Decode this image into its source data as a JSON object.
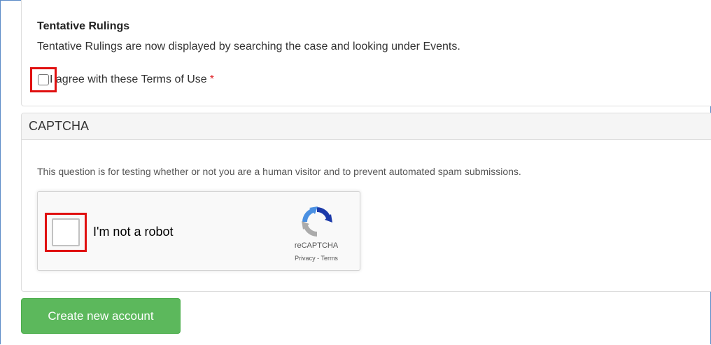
{
  "terms": {
    "heading": "Tentative Rulings",
    "text": "Tentative Rulings are now displayed by searching the case and looking under Events.",
    "agree_label": "I agree with these Terms of Use",
    "required_mark": "*"
  },
  "captcha": {
    "header": "CAPTCHA",
    "description": "This question is for testing whether or not you are a human visitor and to prevent automated spam submissions.",
    "widget": {
      "label": "I'm not a robot",
      "brand": "reCAPTCHA",
      "privacy": "Privacy",
      "separator": "-",
      "terms": "Terms"
    }
  },
  "actions": {
    "create_label": "Create new account"
  },
  "colors": {
    "accent_green": "#5cb85c",
    "highlight_red": "#e01010",
    "required_red": "#e0242a"
  }
}
